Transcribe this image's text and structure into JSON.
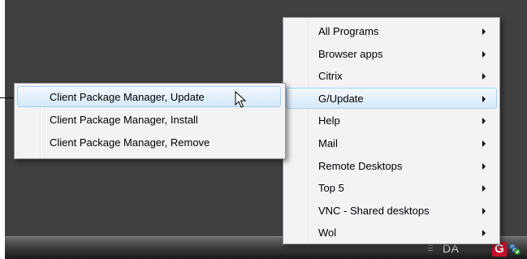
{
  "start_menu": {
    "items": [
      {
        "label": "All Programs",
        "has_submenu": true
      },
      {
        "label": "Browser apps",
        "has_submenu": true
      },
      {
        "label": "Citrix",
        "has_submenu": true
      },
      {
        "label": "G/Update",
        "has_submenu": true,
        "highlighted": true
      },
      {
        "label": "Help",
        "has_submenu": true
      },
      {
        "label": "Mail",
        "has_submenu": true
      },
      {
        "label": "Remote Desktops",
        "has_submenu": true
      },
      {
        "label": "Top 5",
        "has_submenu": true
      },
      {
        "label": "VNC - Shared desktops",
        "has_submenu": true
      },
      {
        "label": "Wol",
        "has_submenu": true
      }
    ]
  },
  "submenu": {
    "items": [
      {
        "label": "Client Package Manager, Update",
        "highlighted": true
      },
      {
        "label": "Client Package Manager, Install"
      },
      {
        "label": "Client Package Manager, Remove"
      }
    ]
  },
  "taskbar": {
    "language": "DA",
    "tray_app_letter": "G"
  },
  "icons": {
    "tray_app": "g-update-icon",
    "network": "network-status-icon",
    "cursor": "mouse-pointer-icon",
    "submenu_arrow": "chevron-right-icon"
  },
  "colors": {
    "highlight_border": "#a8d0f5",
    "highlight_fill": "#d6e9fa",
    "menu_background": "#f3f3f5",
    "tray_app": "#c8102e"
  }
}
